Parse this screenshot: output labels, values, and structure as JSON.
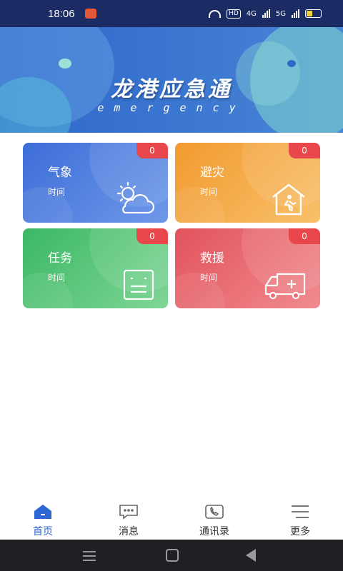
{
  "status_bar": {
    "time": "18:06",
    "hd_label": "HD",
    "net1": "4G",
    "net2": "5G",
    "battery_level": 0.4
  },
  "banner": {
    "title": "龙港应急通",
    "subtitle": "emergency"
  },
  "cards": [
    {
      "title": "气象",
      "subtitle": "时间",
      "badge": "0",
      "icon": "weather-cloud-sun-icon"
    },
    {
      "title": "避灾",
      "subtitle": "时间",
      "badge": "0",
      "icon": "shelter-house-icon"
    },
    {
      "title": "任务",
      "subtitle": "时间",
      "badge": "0",
      "icon": "task-board-icon"
    },
    {
      "title": "救援",
      "subtitle": "时间",
      "badge": "0",
      "icon": "ambulance-icon"
    }
  ],
  "tabs": [
    {
      "label": "首页",
      "icon": "home-icon",
      "active": true
    },
    {
      "label": "消息",
      "icon": "message-icon",
      "active": false
    },
    {
      "label": "通讯录",
      "icon": "phone-book-icon",
      "active": false
    },
    {
      "label": "更多",
      "icon": "menu-lines-icon",
      "active": false
    }
  ],
  "colors": {
    "accent": "#2e66d4",
    "badge": "#e8474b",
    "weather": "#3d6ed8",
    "evac": "#f29a2f",
    "task": "#3bb865",
    "rescue": "#e2535c"
  }
}
